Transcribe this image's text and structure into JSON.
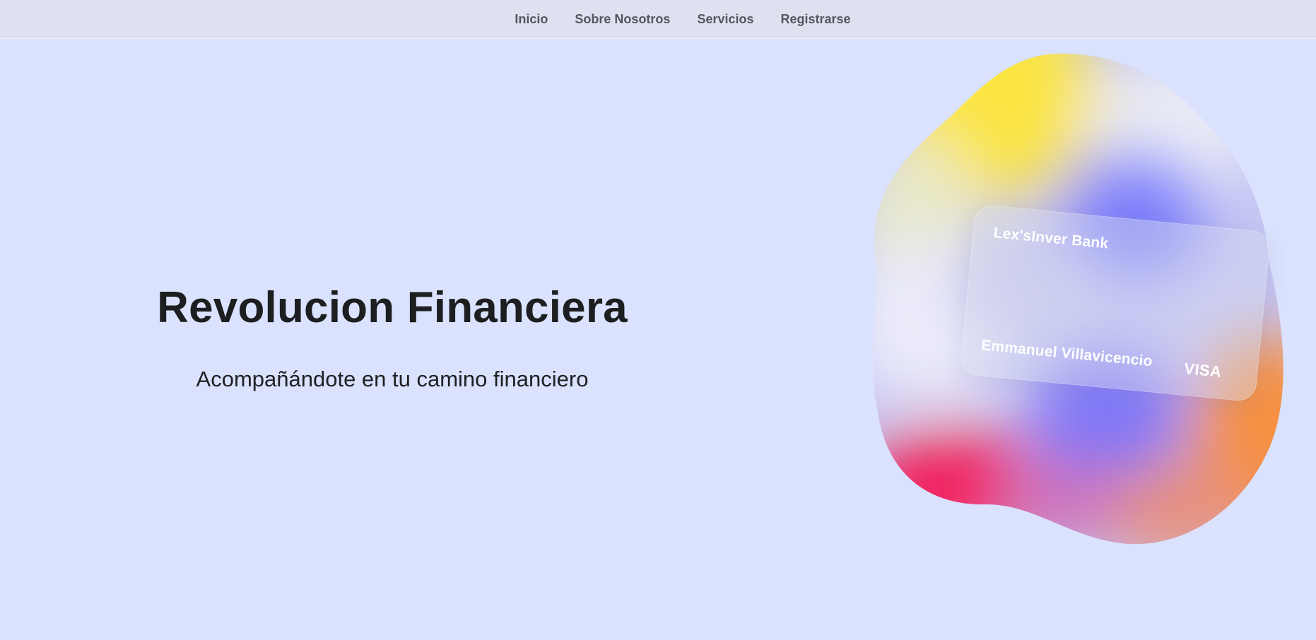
{
  "nav": {
    "items": [
      {
        "label": "Inicio"
      },
      {
        "label": "Sobre Nosotros"
      },
      {
        "label": "Servicios"
      },
      {
        "label": "Registrarse"
      }
    ]
  },
  "hero": {
    "title": "Revolucion Financiera",
    "subtitle": "Acompañándote en tu camino financiero"
  },
  "card": {
    "bank_name": "Lex'sInver Bank",
    "holder_name": "Emmanuel Villavicencio",
    "brand": "VISA"
  },
  "colors": {
    "page_background": "#dae2fd",
    "nav_background": "#dee1ef",
    "nav_text": "#55575f",
    "heading_text": "#1d1e20",
    "card_text": "#ffffff",
    "blob_yellow": "#fbe542",
    "blob_blue": "#7d7dfb",
    "blob_pink": "#f2215f",
    "blob_orange": "#f69042"
  }
}
